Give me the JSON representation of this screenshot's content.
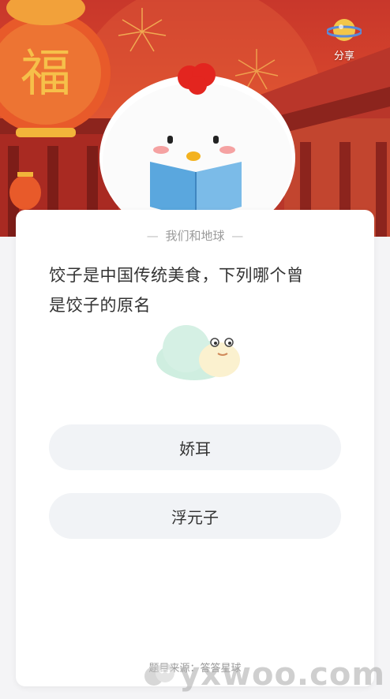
{
  "share": {
    "label": "分享",
    "icon": "share-planet-icon"
  },
  "card": {
    "category": "我们和地球",
    "category_dash_left": "—",
    "category_dash_right": "—",
    "question_line1": "饺子是中国传统美食，下列哪个曾",
    "question_line2": "是饺子的原名",
    "options": [
      {
        "label": "娇耳"
      },
      {
        "label": "浮元子"
      }
    ],
    "source": "题目来源：答答星球"
  },
  "watermark": {
    "text": "yxwoo.com"
  },
  "banner": {
    "lantern_text": "福"
  },
  "colors": {
    "banner_red": "#c8372b",
    "option_bg": "#f1f3f6",
    "text_main": "#333333",
    "text_muted": "#9a9a9a"
  }
}
